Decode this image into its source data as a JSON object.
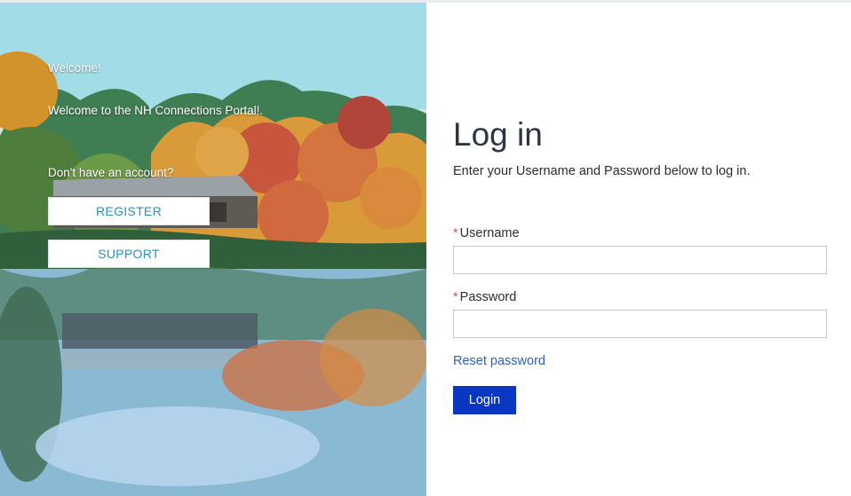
{
  "hero": {
    "welcome": "Welcome!",
    "welcome_message": "Welcome to the NH Connections Portal!.",
    "no_account": "Don't have an account?",
    "register_label": "REGISTER",
    "support_label": "SUPPORT"
  },
  "login": {
    "title": "Log in",
    "subtitle": "Enter your Username and Password below to log in.",
    "required_mark": "*",
    "username_label": "Username",
    "username_value": "",
    "password_label": "Password",
    "password_value": "",
    "reset_label": "Reset password",
    "login_button": "Login"
  },
  "colors": {
    "accent": "#0b36c1",
    "link": "#2f5fc0",
    "register_text": "#2a8fc7",
    "required": "#d9534f"
  }
}
